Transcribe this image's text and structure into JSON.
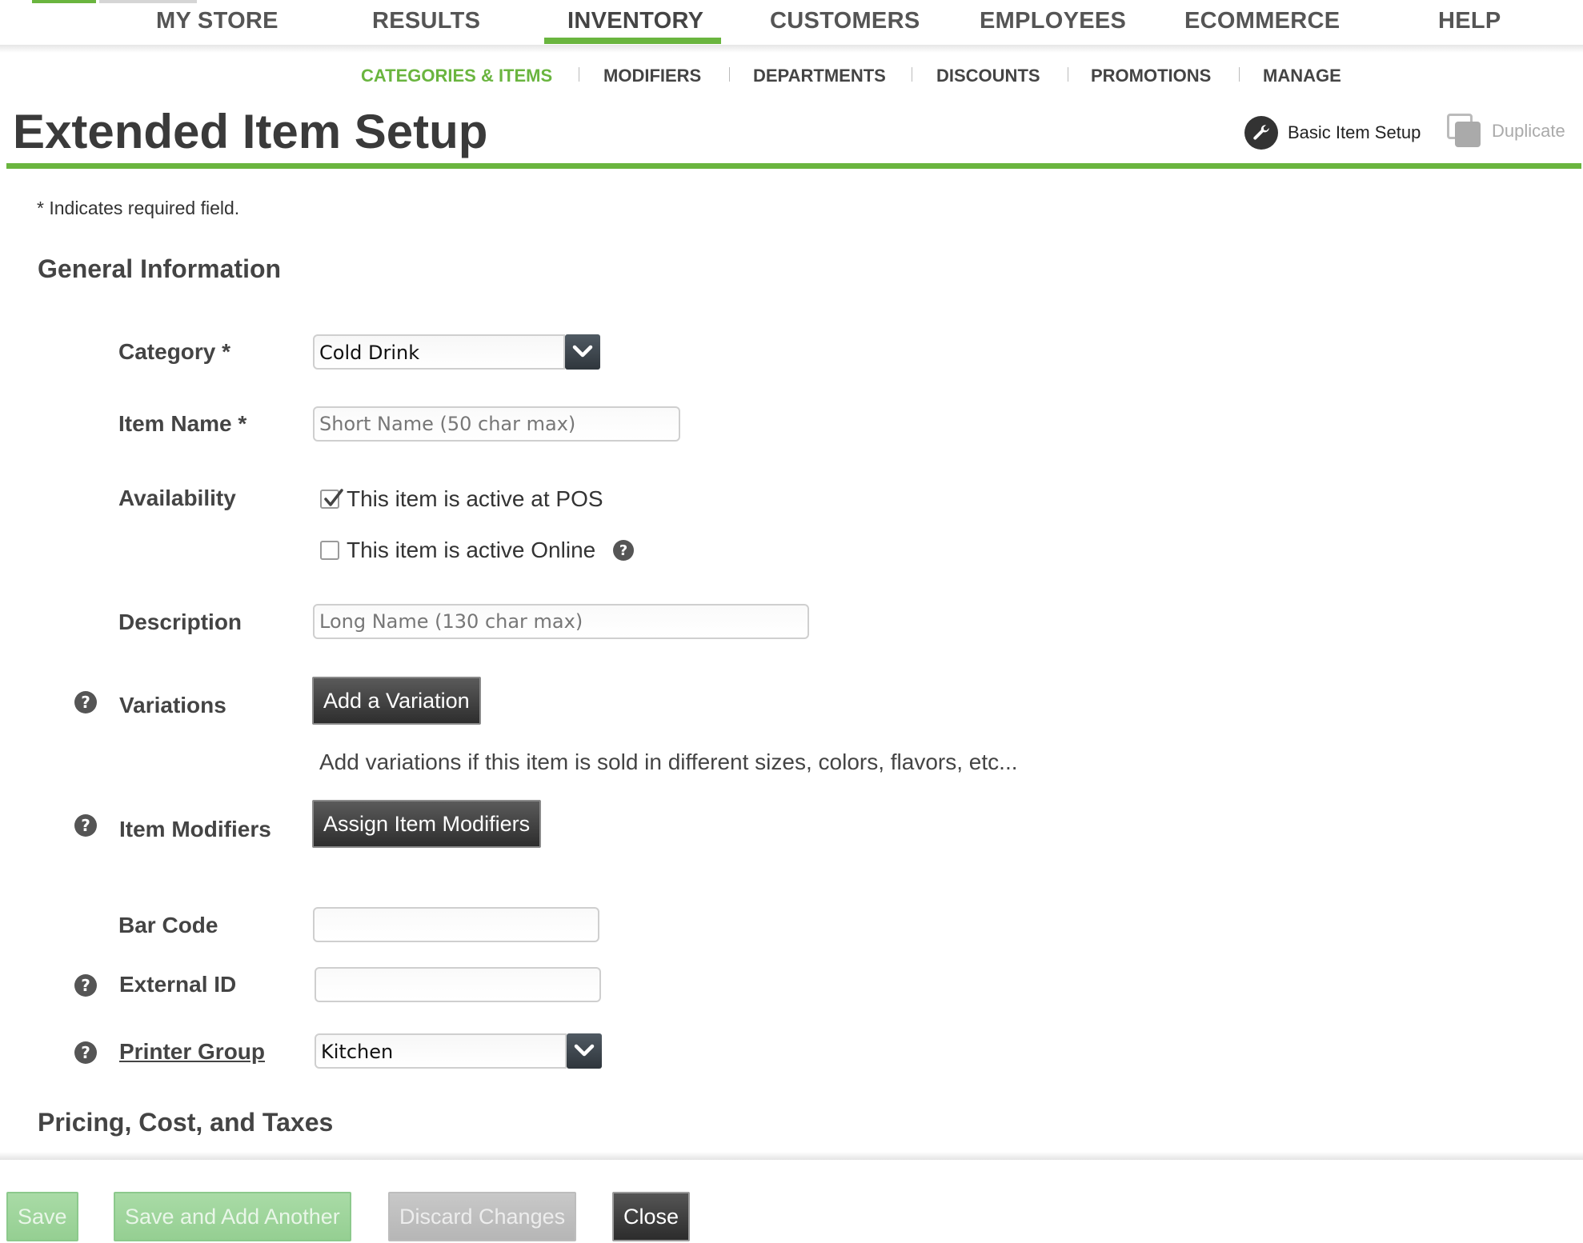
{
  "colors": {
    "accent_green": "#6ab53f",
    "text_dark": "#444444",
    "muted_gray": "#aaaaaa"
  },
  "main_nav": {
    "items": [
      "MY STORE",
      "RESULTS",
      "INVENTORY",
      "CUSTOMERS",
      "EMPLOYEES",
      "ECOMMERCE",
      "HELP"
    ],
    "active": "INVENTORY"
  },
  "sub_nav": {
    "items": [
      "CATEGORIES & ITEMS",
      "MODIFIERS",
      "DEPARTMENTS",
      "DISCOUNTS",
      "PROMOTIONS",
      "MANAGE"
    ],
    "active": "CATEGORIES & ITEMS"
  },
  "header": {
    "title": "Extended Item Setup",
    "basic_setup_label": "Basic Item Setup",
    "basic_setup_icon": "wrench-icon",
    "duplicate_label": "Duplicate",
    "duplicate_icon": "duplicate-icon"
  },
  "required_note": "* Indicates required field.",
  "general": {
    "title": "General Information",
    "category": {
      "label": "Category *",
      "value": "Cold Drink"
    },
    "item_name": {
      "label": "Item Name *",
      "placeholder": "Short Name (50 char max)"
    },
    "availability": {
      "label": "Availability",
      "pos": {
        "label": "This item is active at POS",
        "checked": true
      },
      "online": {
        "label": "This item is active Online",
        "checked": false
      }
    },
    "description": {
      "label": "Description",
      "placeholder": "Long Name (130 char max)"
    },
    "variations": {
      "label": "Variations",
      "button": "Add a Variation",
      "hint": "Add variations if this item is sold in different sizes, colors, flavors, etc..."
    },
    "modifiers": {
      "label": "Item Modifiers",
      "button": "Assign Item Modifiers"
    },
    "bar_code": {
      "label": "Bar Code",
      "value": ""
    },
    "external_id": {
      "label": "External ID",
      "value": ""
    },
    "printer_group": {
      "label": "Printer Group",
      "value": "Kitchen"
    }
  },
  "pricing": {
    "title": "Pricing, Cost, and Taxes"
  },
  "footer": {
    "save": "Save",
    "save_add": "Save and Add Another",
    "discard": "Discard Changes",
    "close": "Close"
  }
}
